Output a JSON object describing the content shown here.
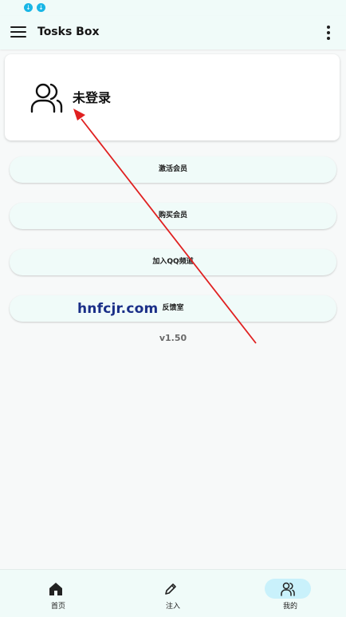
{
  "app": {
    "title": "Tosks Box"
  },
  "profile": {
    "status": "未登录"
  },
  "actions": [
    {
      "label": "激活会员"
    },
    {
      "label": "购买会员"
    },
    {
      "label": "加入QQ频道"
    },
    {
      "label": "反馈室"
    }
  ],
  "version": "v1.50",
  "watermark": "hnfcjr.com",
  "bottom_nav": {
    "items": [
      {
        "label": "首页",
        "icon": "home-icon"
      },
      {
        "label": "注入",
        "icon": "pencil-icon"
      },
      {
        "label": "我的",
        "icon": "user-icon",
        "active": true
      }
    ]
  },
  "colors": {
    "background": "#f7f9f9",
    "bars": "#f0fbf9",
    "active_indicator": "#c9f1fb",
    "annotation_arrow": "#e02020",
    "watermark": "#1a2f88"
  }
}
